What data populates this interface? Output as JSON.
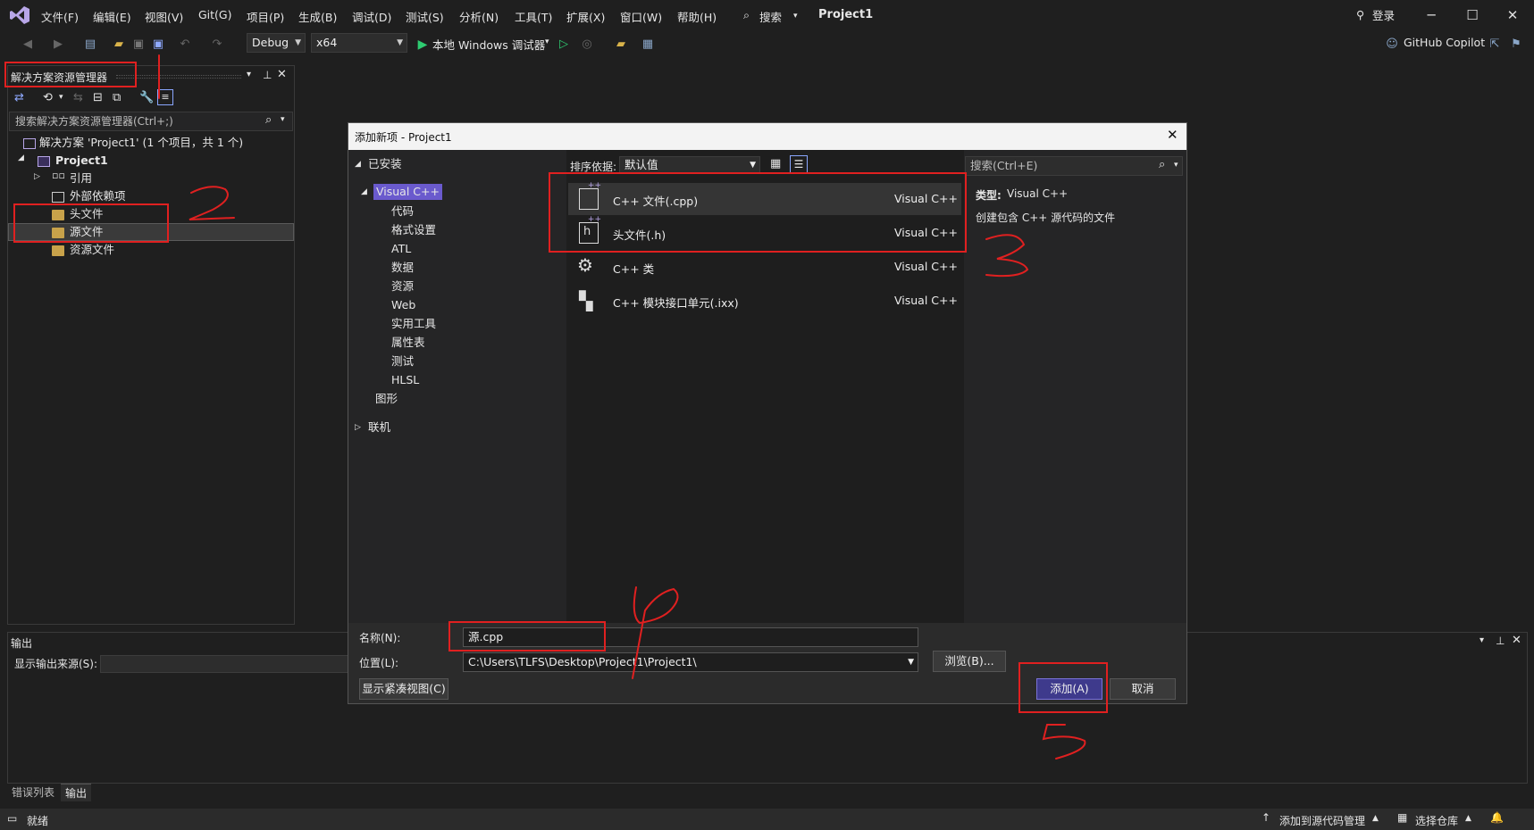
{
  "menu": {
    "items": [
      "文件(F)",
      "编辑(E)",
      "视图(V)",
      "Git(G)",
      "项目(P)",
      "生成(B)",
      "调试(D)",
      "测试(S)",
      "分析(N)",
      "工具(T)",
      "扩展(X)",
      "窗口(W)",
      "帮助(H)"
    ],
    "search": "搜索",
    "project_title": "Project1",
    "login": "登录"
  },
  "toolbar": {
    "config": "Debug",
    "platform": "x64",
    "run_label": "本地 Windows 调试器",
    "copilot": "GitHub Copilot"
  },
  "solution_explorer": {
    "title": "解决方案资源管理器",
    "search_placeholder": "搜索解决方案资源管理器(Ctrl+;)",
    "solution": "解决方案 'Project1' (1 个项目，共 1 个)",
    "project": "Project1",
    "items": [
      "引用",
      "外部依赖项",
      "头文件",
      "源文件",
      "资源文件"
    ]
  },
  "output": {
    "title": "输出",
    "source_label": "显示输出来源(S):",
    "tabs": [
      "错误列表",
      "输出"
    ]
  },
  "status": {
    "ready": "就绪",
    "source_control": "添加到源代码管理",
    "repo": "选择仓库"
  },
  "dialog": {
    "title": "添加新项 - Project1",
    "installed": "已安装",
    "tree": {
      "root": "Visual C++",
      "children": [
        "代码",
        "格式设置",
        "ATL",
        "数据",
        "资源",
        "Web",
        "实用工具",
        "属性表",
        "测试",
        "HLSL"
      ],
      "graphics": "图形",
      "online": "联机"
    },
    "sort_label": "排序依据:",
    "sort_value": "默认值",
    "search_placeholder": "搜索(Ctrl+E)",
    "templates": [
      {
        "name": "C++ 文件(.cpp)",
        "lang": "Visual C++"
      },
      {
        "name": "头文件(.h)",
        "lang": "Visual C++"
      },
      {
        "name": "C++ 类",
        "lang": "Visual C++"
      },
      {
        "name": "C++ 模块接口单元(.ixx)",
        "lang": "Visual C++"
      }
    ],
    "detail_type_label": "类型:",
    "detail_type_value": "Visual C++",
    "detail_desc": "创建包含 C++ 源代码的文件",
    "name_label": "名称(N):",
    "name_value": "源.cpp",
    "location_label": "位置(L):",
    "location_value": "C:\\Users\\TLFS\\Desktop\\Project1\\Project1\\",
    "browse": "浏览(B)...",
    "compact_view": "显示紧凑视图(C)",
    "add": "添加(A)",
    "cancel": "取消"
  },
  "colors": {
    "accent": "#3e3a8c",
    "annotation": "#e02020",
    "tree_selected": "#6a5acd"
  }
}
